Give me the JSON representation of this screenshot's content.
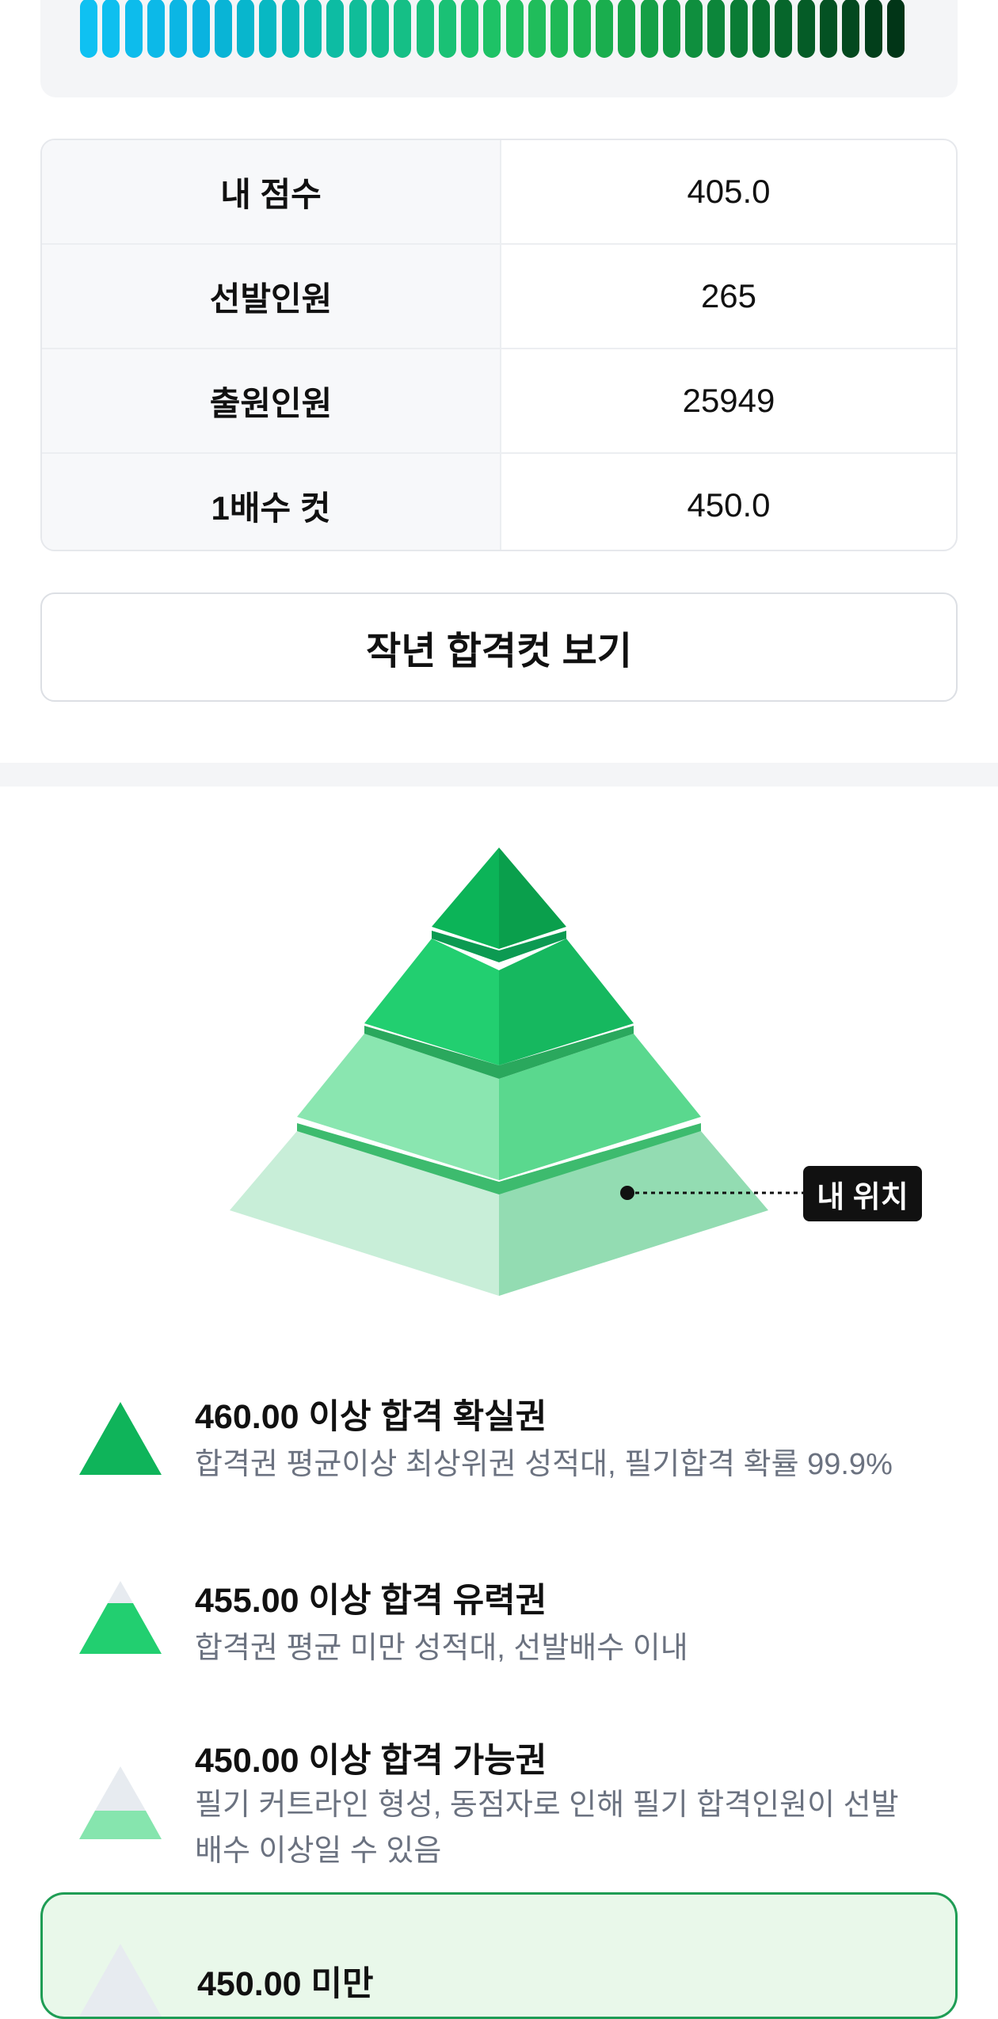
{
  "gauge": {
    "colors": [
      "#0fc1f2",
      "#0ebfef",
      "#0dbcec",
      "#0cb9e8",
      "#0bb6e4",
      "#0ab3e0",
      "#09b4d6",
      "#08b6cd",
      "#08b8c3",
      "#09b9b8",
      "#0bbbad",
      "#0dbca3",
      "#10bd99",
      "#12be90",
      "#15bf86",
      "#18c07d",
      "#1ac175",
      "#1cc26d",
      "#1ec266",
      "#1fc060",
      "#20bd5b",
      "#1fb956",
      "#1db452",
      "#1aae4e",
      "#17a74a",
      "#14a046",
      "#119842",
      "#0f8f3e",
      "#0c863a",
      "#0a7c35",
      "#087130",
      "#06662b",
      "#055c27",
      "#045223",
      "#03491f",
      "#023f1b",
      "#013517"
    ]
  },
  "stats": {
    "rows": [
      {
        "label": "내 점수",
        "value": "405.0"
      },
      {
        "label": "선발인원",
        "value": "265"
      },
      {
        "label": "출원인원",
        "value": "25949"
      },
      {
        "label": "1배수 컷",
        "value": "450.0"
      }
    ]
  },
  "last_year_button": {
    "label": "작년 합격컷 보기"
  },
  "pyramid": {
    "my_position_label": "내 위치"
  },
  "legend": [
    {
      "title": "460.00 이상 합격 확실권",
      "desc": "합격권 평균이상 최상위권 성적대, 필기합격 확률 99.9%",
      "icon": "pyramid-tier-top-icon"
    },
    {
      "title": "455.00 이상 합격 유력권",
      "desc": "합격권 평균 미만 성적대, 선발배수 이내",
      "icon": "pyramid-tier-second-icon"
    },
    {
      "title": "450.00 이상 합격 가능권",
      "desc": "필기 커트라인 형성, 동점자로 인해 필기 합격인원이 선발 배수 이상일 수 있음",
      "icon": "pyramid-tier-third-icon"
    },
    {
      "title": "450.00 미만",
      "icon": "pyramid-tier-bottom-icon"
    }
  ],
  "colors": {
    "accent": "#1f9d55",
    "tier_top": "#0fb45a",
    "tier_second": "#22cf70",
    "tier_third": "#86e5ae",
    "tier_bottom": "#c8eed8"
  }
}
